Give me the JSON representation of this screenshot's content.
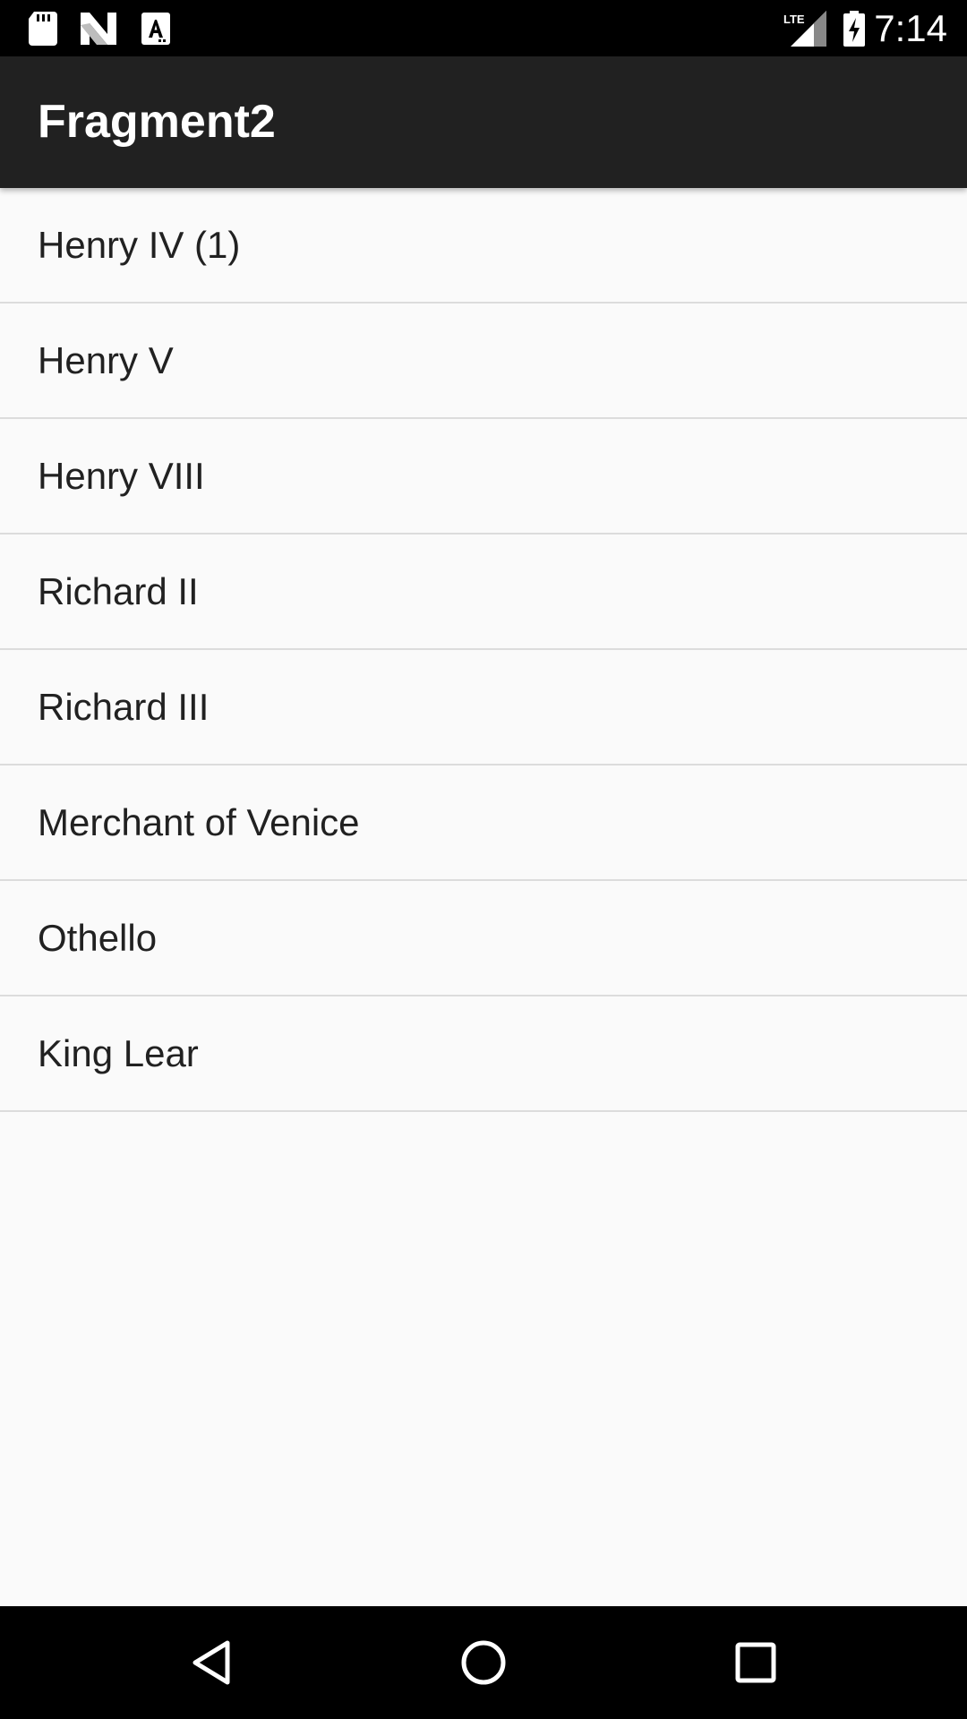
{
  "status_bar": {
    "time": "7:14",
    "left_icons": [
      "sd-card-icon",
      "n-notification-icon",
      "font-a-icon"
    ],
    "right_icons": [
      "lte-signal-icon",
      "battery-charging-icon"
    ],
    "lte_label": "LTE"
  },
  "app_bar": {
    "title": "Fragment2"
  },
  "list": {
    "items": [
      {
        "label": "Henry IV (1)"
      },
      {
        "label": "Henry V"
      },
      {
        "label": "Henry VIII"
      },
      {
        "label": "Richard II"
      },
      {
        "label": "Richard III"
      },
      {
        "label": "Merchant of Venice"
      },
      {
        "label": "Othello"
      },
      {
        "label": "King Lear"
      }
    ]
  },
  "nav_bar": {
    "buttons": [
      "back-icon",
      "home-icon",
      "recents-icon"
    ]
  },
  "colors": {
    "status_bar": "#000000",
    "app_bar": "#212121",
    "background": "#fafafa",
    "divider": "#dcdcdc",
    "text": "#212121",
    "nav_bar": "#000000"
  }
}
